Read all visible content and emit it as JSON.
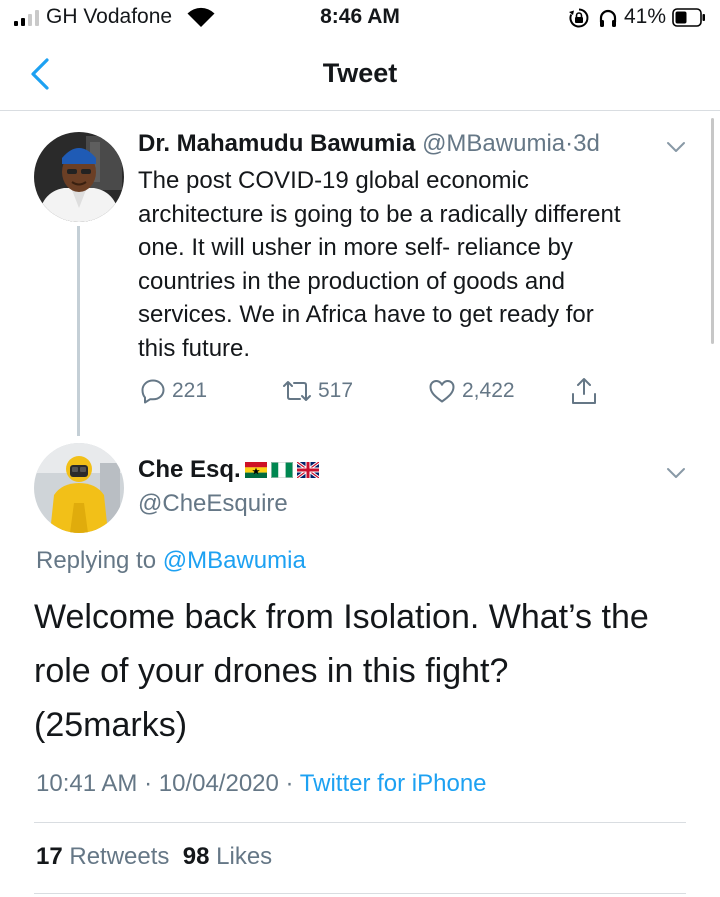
{
  "status_bar": {
    "carrier": "GH Vodafone",
    "time": "8:46 AM",
    "battery": "41%"
  },
  "nav": {
    "title": "Tweet"
  },
  "original_tweet": {
    "author_name": "Dr. Mahamudu Bawumia",
    "handle": "@MBawumia",
    "separator": "·",
    "age": "3d",
    "text": "The post COVID-19 global economic\narchitecture is going to be a radically different\none. It will usher in more self- reliance by\ncountries in the production of goods and\nservices. We in Africa have to get ready for\nthis future.",
    "replies": "221",
    "retweets": "517",
    "likes": "2,422"
  },
  "reply_tweet": {
    "author_name": "Che Esq.",
    "author_flags": [
      "ghana-flag-icon",
      "nigeria-flag-icon",
      "uk-flag-icon"
    ],
    "handle": "@CheEsquire",
    "replying_label": "Replying to",
    "replying_to": "@MBawumia",
    "text": "Welcome back from Isolation. What’s the\nrole of your drones in this fight?\n(25marks)",
    "time": "10:41 AM",
    "date": "10/04/2020",
    "dot": "·",
    "source": "Twitter for iPhone",
    "retweet_count": "17",
    "retweet_label": "Retweets",
    "like_count": "98",
    "like_label": "Likes"
  },
  "colors": {
    "accent": "#1da1f2",
    "muted": "#657786",
    "text": "#14171a",
    "divider": "#d9dde1"
  }
}
